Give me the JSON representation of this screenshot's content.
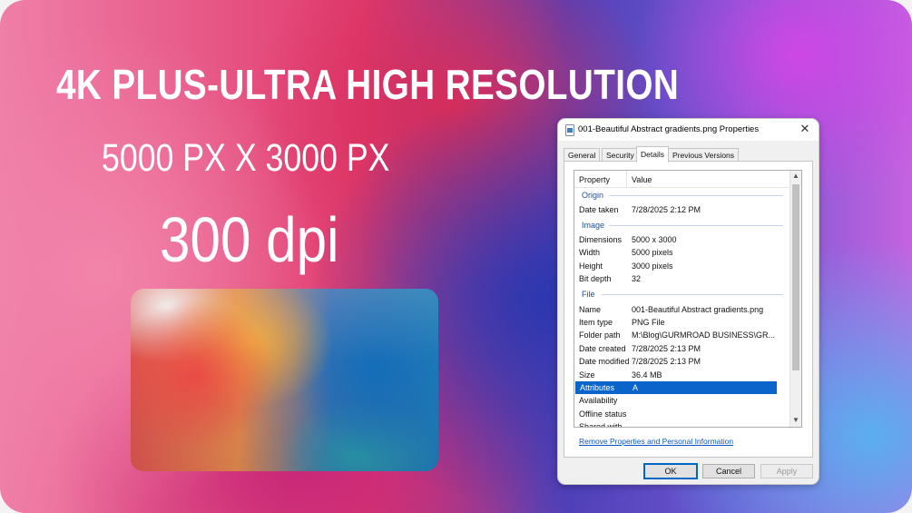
{
  "banner": {
    "headline": "4K PLUS-ULTRA HIGH RESOLUTION",
    "size": "5000 PX X 3000 PX",
    "dpi": "300 dpi"
  },
  "dialog": {
    "title": "001-Beautiful Abstract gradients.png Properties",
    "close": "✕",
    "tabs": [
      "General",
      "Security",
      "Details",
      "Previous Versions"
    ],
    "active_tab": "Details",
    "columns": {
      "property": "Property",
      "value": "Value"
    },
    "groups": {
      "origin": "Origin",
      "image": "Image",
      "file": "File"
    },
    "rows": [
      {
        "k": "Date taken",
        "v": "7/28/2025 2:12 PM"
      },
      {
        "k": "Dimensions",
        "v": "5000 x 3000"
      },
      {
        "k": "Width",
        "v": "5000 pixels"
      },
      {
        "k": "Height",
        "v": "3000 pixels"
      },
      {
        "k": "Bit depth",
        "v": "32"
      },
      {
        "k": "Name",
        "v": "001-Beautiful Abstract gradients.png"
      },
      {
        "k": "Item type",
        "v": "PNG File"
      },
      {
        "k": "Folder path",
        "v": "M:\\Blog\\GURMROAD BUSINESS\\GR..."
      },
      {
        "k": "Date created",
        "v": "7/28/2025 2:13 PM"
      },
      {
        "k": "Date modified",
        "v": "7/28/2025 2:13 PM"
      },
      {
        "k": "Size",
        "v": "36.4 MB"
      },
      {
        "k": "Attributes",
        "v": "A"
      },
      {
        "k": "Availability",
        "v": ""
      },
      {
        "k": "Offline status",
        "v": ""
      },
      {
        "k": "Shared with",
        "v": ""
      }
    ],
    "selected_row": "Attributes",
    "remove_link": "Remove Properties and Personal Information",
    "buttons": {
      "ok": "OK",
      "cancel": "Cancel",
      "apply": "Apply"
    }
  }
}
